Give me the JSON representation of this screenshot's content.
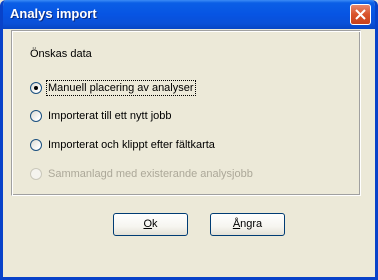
{
  "window": {
    "title": "Analys import",
    "close_icon": "close-icon"
  },
  "group": {
    "heading": "Önskas data"
  },
  "options": [
    {
      "label": "Manuell placering av analyser",
      "checked": true,
      "enabled": true
    },
    {
      "label": "Importerat till ett nytt jobb",
      "checked": false,
      "enabled": true
    },
    {
      "label": "Importerat och klippt efter fältkarta",
      "checked": false,
      "enabled": true
    },
    {
      "label": "Sammanlagd med existerande analysjobb",
      "checked": false,
      "enabled": false
    }
  ],
  "buttons": {
    "ok": {
      "label_rest": "k",
      "mnemonic": "O"
    },
    "cancel": {
      "label_rest": "ngra",
      "mnemonic": "Å"
    }
  },
  "colors": {
    "titlebar": "#0754e3",
    "close": "#d9542b",
    "face": "#ece9d8",
    "disabled_text": "#aca899"
  }
}
